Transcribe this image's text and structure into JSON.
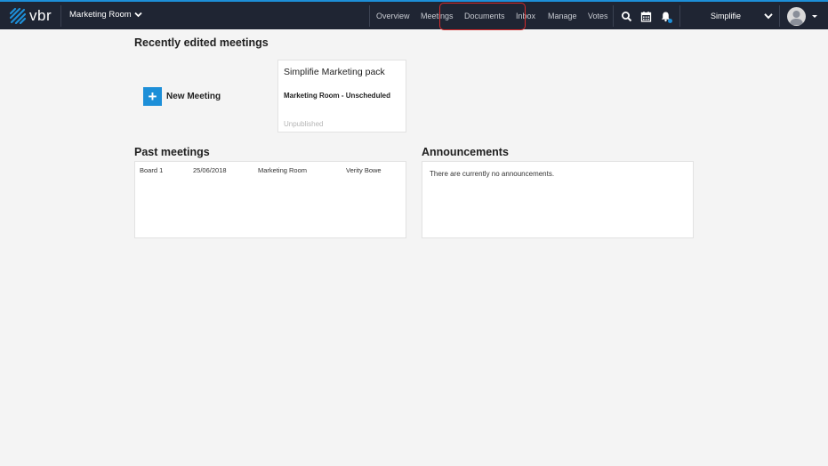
{
  "header": {
    "logo_text": "vbr",
    "room_name": "Marketing Room",
    "nav": [
      {
        "label": "Overview"
      },
      {
        "label": "Meetings"
      },
      {
        "label": "Documents"
      },
      {
        "label": "Inbox"
      },
      {
        "label": "Manage"
      },
      {
        "label": "Votes"
      }
    ],
    "icons": [
      "search-icon",
      "calendar-icon",
      "bell-icon"
    ],
    "org_name": "Simplifie",
    "colors": {
      "bar": "#1f2533",
      "accent": "#1d8fd8",
      "highlight": "#d62b2b"
    }
  },
  "recent": {
    "title": "Recently edited meetings",
    "new_meeting_label": "New Meeting",
    "pack": {
      "title": "Simplifie Marketing pack",
      "subtitle": "Marketing Room - Unscheduled",
      "status": "Unpublished"
    }
  },
  "past": {
    "title": "Past meetings",
    "rows": [
      {
        "name": "Board 1",
        "date": "25/06/2018",
        "room": "Marketing Room",
        "person": "Verity Bowe"
      }
    ]
  },
  "announcements": {
    "title": "Announcements",
    "empty_text": "There are currently no announcements."
  }
}
